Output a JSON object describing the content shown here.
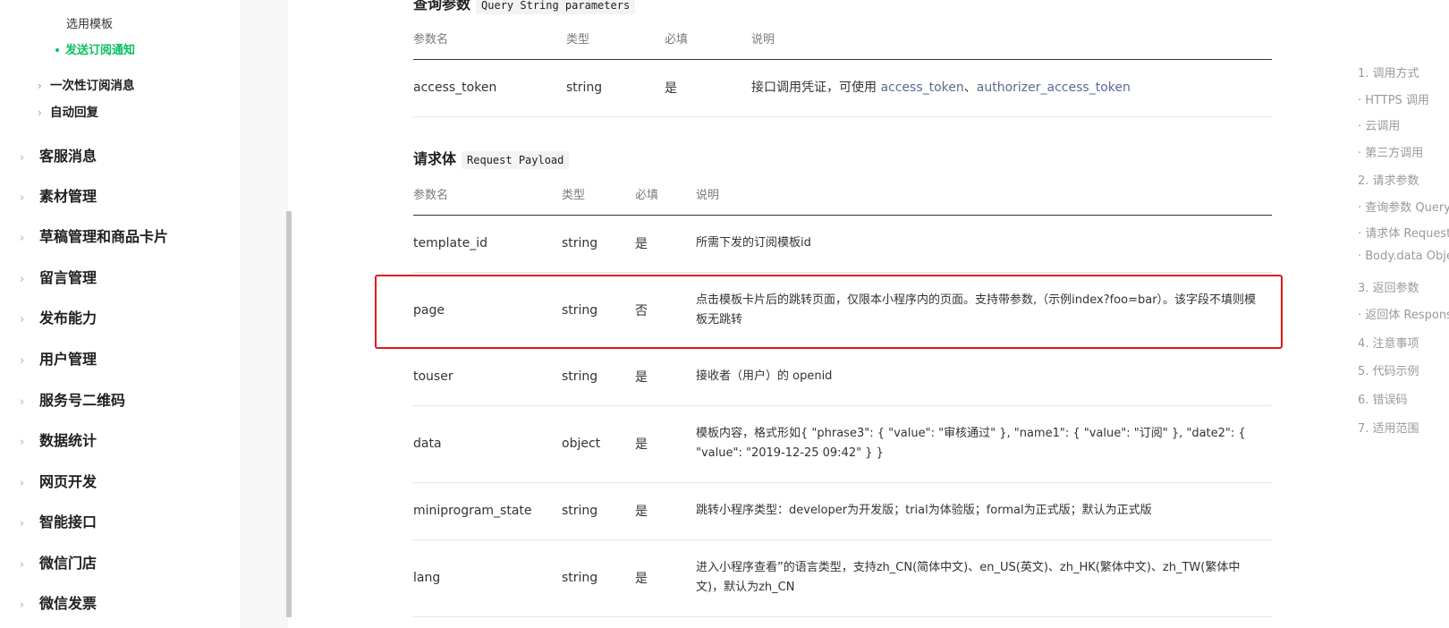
{
  "sidebar": {
    "sub_items": [
      "选用模板",
      "发送订阅通知"
    ],
    "sub_groups": [
      "一次性订阅消息",
      "自动回复"
    ],
    "top_items": [
      "客服消息",
      "素材管理",
      "草稿管理和商品卡片",
      "留言管理",
      "发布能力",
      "用户管理",
      "服务号二维码",
      "数据统计",
      "网页开发",
      "智能接口",
      "微信门店",
      "微信发票"
    ]
  },
  "query_section": {
    "title": "查询参数",
    "code": "Query String parameters",
    "headers": [
      "参数名",
      "类型",
      "必填",
      "说明"
    ],
    "rows": [
      {
        "name": "access_token",
        "type": "string",
        "required": "是",
        "desc_prefix": "接口调用凭证，可使用 ",
        "link1": "access_token",
        "sep": "、",
        "link2": "authorizer_access_token"
      }
    ]
  },
  "payload_section": {
    "title": "请求体",
    "code": "Request Payload",
    "headers": [
      "参数名",
      "类型",
      "必填",
      "说明"
    ],
    "rows": [
      {
        "name": "template_id",
        "type": "string",
        "required": "是",
        "desc": "所需下发的订阅模板id"
      },
      {
        "name": "page",
        "type": "string",
        "required": "否",
        "desc": "点击模板卡片后的跳转页面，仅限本小程序内的页面。支持带参数,（示例index?foo=bar）。该字段不填则模板无跳转"
      },
      {
        "name": "touser",
        "type": "string",
        "required": "是",
        "desc": "接收者（用户）的 openid"
      },
      {
        "name": "data",
        "type": "object",
        "required": "是",
        "desc": "模板内容，格式形如{ \"phrase3\": { \"value\": \"审核通过\" }, \"name1\": { \"value\": \"订阅\" }, \"date2\": { \"value\": \"2019-12-25 09:42\" } }"
      },
      {
        "name": "miniprogram_state",
        "type": "string",
        "required": "是",
        "desc": "跳转小程序类型：developer为开发版；trial为体验版；formal为正式版；默认为正式版"
      },
      {
        "name": "lang",
        "type": "string",
        "required": "是",
        "desc": "进入小程序查看”的语言类型，支持zh_CN(简体中文)、en_US(英文)、zh_HK(繁体中文)、zh_TW(繁体中文)，默认为zh_CN"
      }
    ]
  },
  "toc": {
    "items": [
      "1. 调用方式",
      "· HTTPS 调用",
      "· 云调用",
      "· 第三方调用",
      "2. 请求参数",
      "· 查询参数 Query String parameters",
      "· 请求体 Request Payload",
      "· Body.data Object Payload",
      "3. 返回参数",
      "· 返回体 Response Payload",
      "4. 注意事项",
      "5. 代码示例",
      "6. 错误码",
      "7. 适用范围"
    ]
  },
  "colors": {
    "accent_green": "#07c160",
    "link": "#576b95",
    "highlight": "#e0191b"
  }
}
